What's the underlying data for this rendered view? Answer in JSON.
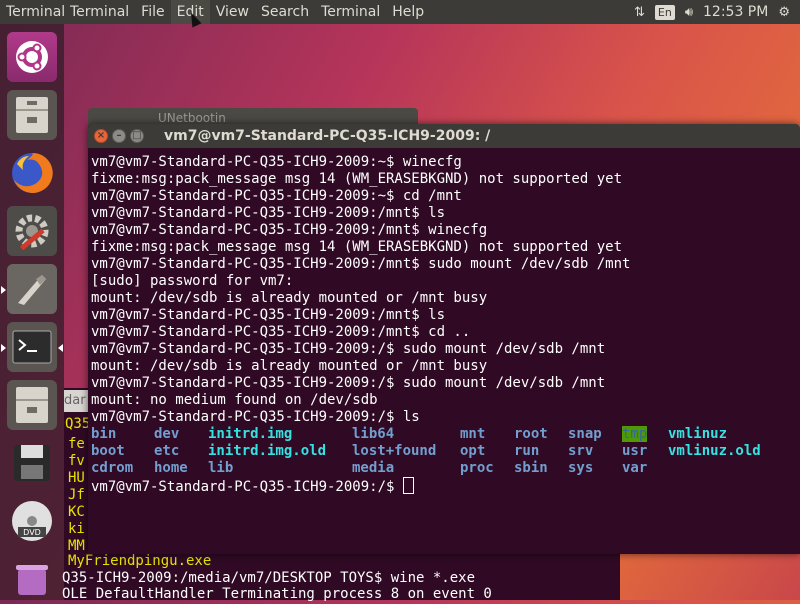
{
  "topbar": {
    "app_title": "Terminal",
    "menu": [
      "Terminal",
      "File",
      "Edit",
      "View",
      "Search",
      "Terminal",
      "Help"
    ],
    "active_menu_index": 2,
    "lang": "En",
    "time": "12:53 PM"
  },
  "launcher": {
    "items": [
      "ubuntu-dash",
      "files",
      "firefox",
      "system-settings",
      "wine-app",
      "terminal",
      "files-2",
      "save-disk",
      "dvd",
      "trash"
    ]
  },
  "hidden_window": {
    "title": "UNetbootin"
  },
  "background_terminal": {
    "title": "dar",
    "lines": [
      "Q35",
      "fe",
      "fv",
      "HU",
      "Jf",
      "KC",
      "ki",
      "MM",
      "MyFriendpingu.exe",
      "Q35-ICH9-2009:/media/vm7/DESKTOP TOYS$ wine *.exe",
      "OLE DefaultHandler Terminating process 8 on event 0"
    ]
  },
  "terminal": {
    "title": "vm7@vm7-Standard-PC-Q35-ICH9-2009: /",
    "lines": [
      "vm7@vm7-Standard-PC-Q35-ICH9-2009:~$ winecfg",
      "fixme:msg:pack_message msg 14 (WM_ERASEBKGND) not supported yet",
      "vm7@vm7-Standard-PC-Q35-ICH9-2009:~$ cd /mnt",
      "vm7@vm7-Standard-PC-Q35-ICH9-2009:/mnt$ ls",
      "vm7@vm7-Standard-PC-Q35-ICH9-2009:/mnt$ winecfg",
      "fixme:msg:pack_message msg 14 (WM_ERASEBKGND) not supported yet",
      "vm7@vm7-Standard-PC-Q35-ICH9-2009:/mnt$ sudo mount /dev/sdb /mnt",
      "[sudo] password for vm7:",
      "mount: /dev/sdb is already mounted or /mnt busy",
      "vm7@vm7-Standard-PC-Q35-ICH9-2009:/mnt$ ls",
      "vm7@vm7-Standard-PC-Q35-ICH9-2009:/mnt$ cd ..",
      "vm7@vm7-Standard-PC-Q35-ICH9-2009:/$ sudo mount /dev/sdb /mnt",
      "mount: /dev/sdb is already mounted or /mnt busy",
      "vm7@vm7-Standard-PC-Q35-ICH9-2009:/$ sudo mount /dev/sdb /mnt",
      "mount: no medium found on /dev/sdb",
      "vm7@vm7-Standard-PC-Q35-ICH9-2009:/$ ls"
    ],
    "ls_rows": [
      [
        "bin",
        "dev",
        "initrd.img",
        "lib64",
        "mnt",
        "root",
        "snap",
        "tmp",
        "vmlinuz"
      ],
      [
        "boot",
        "etc",
        "initrd.img.old",
        "lost+found",
        "opt",
        "run",
        "srv",
        "usr",
        "vmlinuz.old"
      ],
      [
        "cdrom",
        "home",
        "lib",
        "media",
        "proc",
        "sbin",
        "sys",
        "var",
        ""
      ]
    ],
    "prompt": "vm7@vm7-Standard-PC-Q35-ICH9-2009:/$ "
  },
  "colors": {
    "terminal_bg": "#300a24",
    "dir_blue": "#729fcf",
    "tmp_bg": "#4e9a06"
  }
}
